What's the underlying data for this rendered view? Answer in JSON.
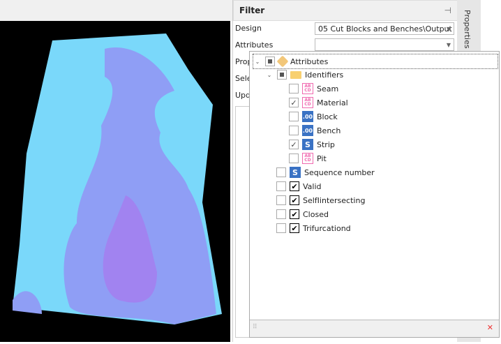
{
  "filter": {
    "title": "Filter",
    "design_label": "Design",
    "design_value": "05 Cut Blocks and Benches\\Output",
    "attributes_label": "Attributes",
    "attributes_value": "",
    "prop_label": "Prop",
    "select_label": "Selec",
    "update_label": "Upda"
  },
  "side_tab": "Properties",
  "tree": {
    "root": "Attributes",
    "group": "Identifiers",
    "children": [
      {
        "label": "Seam",
        "checked": false,
        "icon": "text"
      },
      {
        "label": "Material",
        "checked": true,
        "icon": "text"
      },
      {
        "label": "Block",
        "checked": false,
        "icon": "numeric"
      },
      {
        "label": "Bench",
        "checked": false,
        "icon": "numeric"
      },
      {
        "label": "Strip",
        "checked": true,
        "icon": "sequence"
      },
      {
        "label": "Pit",
        "checked": false,
        "icon": "text"
      }
    ],
    "others": [
      {
        "label": "Sequence number",
        "icon": "sequence"
      },
      {
        "label": "Valid",
        "icon": "boolean"
      },
      {
        "label": "SelfIintersecting",
        "icon": "boolean"
      },
      {
        "label": "Closed",
        "icon": "boolean"
      },
      {
        "label": "Trifurcationd",
        "icon": "boolean"
      }
    ]
  }
}
